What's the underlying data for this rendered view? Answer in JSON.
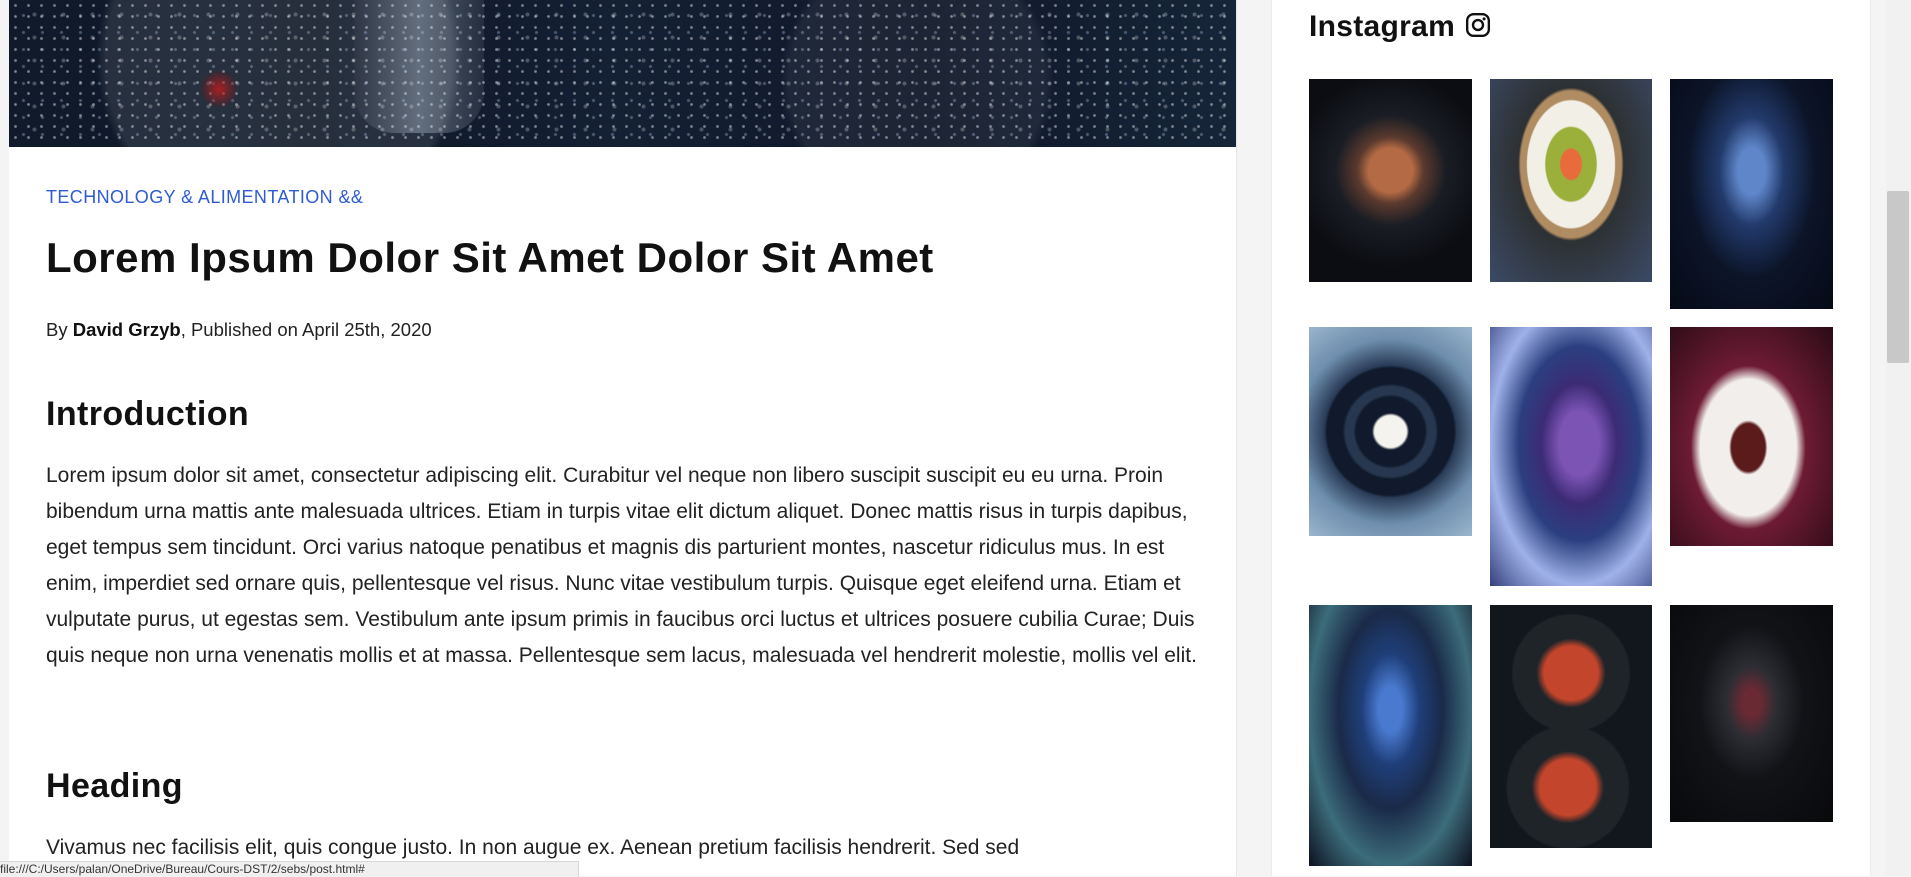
{
  "article": {
    "category": "TECHNOLOGY & ALIMENTATION &&",
    "title": "Lorem Ipsum Dolor Sit Amet Dolor Sit Amet",
    "byline": {
      "prefix": "By ",
      "author": "David Grzyb",
      "suffix": ", Published on April 25th, 2020"
    },
    "sections": [
      {
        "heading": "Introduction",
        "text": "Lorem ipsum dolor sit amet, consectetur adipiscing elit. Curabitur vel neque non libero suscipit suscipit eu eu urna. Proin bibendum urna mattis ante malesuada ultrices. Etiam in turpis vitae elit dictum aliquet. Donec mattis risus in turpis dapibus, eget tempus sem tincidunt. Orci varius natoque penatibus et magnis dis parturient montes, nascetur ridiculus mus. In est enim, imperdiet sed ornare quis, pellentesque vel risus. Nunc vitae vestibulum turpis. Quisque eget eleifend urna. Etiam et vulputate purus, ut egestas sem. Vestibulum ante ipsum primis in faucibus orci luctus et ultrices posuere cubilia Curae; Duis quis neque non urna venenatis mollis et at massa. Pellentesque sem lacus, malesuada vel hendrerit molestie, mollis vel elit."
      },
      {
        "heading": "Heading",
        "text": "Vivamus nec facilisis elit, quis congue justo. In non augue ex. Aenean pretium facilisis hendrerit. Sed sed"
      }
    ]
  },
  "sidebar": {
    "instagram": {
      "title": "Instagram",
      "icon": "instagram-icon",
      "thumbnails": [
        {
          "name": "instagram-thumb-mechanical-heart"
        },
        {
          "name": "instagram-thumb-salmon-dish"
        },
        {
          "name": "instagram-thumb-blue-mech-robot"
        },
        {
          "name": "instagram-thumb-black-plate-dessert"
        },
        {
          "name": "instagram-thumb-purple-robot"
        },
        {
          "name": "instagram-thumb-meat-carrot-dish"
        },
        {
          "name": "instagram-thumb-blue-cyborg-woman"
        },
        {
          "name": "instagram-thumb-pasta-bowls"
        },
        {
          "name": "instagram-thumb-black-robot"
        }
      ]
    }
  },
  "status_bar": {
    "url": "file:///C:/Users/palan/OneDrive/Bureau/Cours-DST/2/sebs/post.html#"
  }
}
